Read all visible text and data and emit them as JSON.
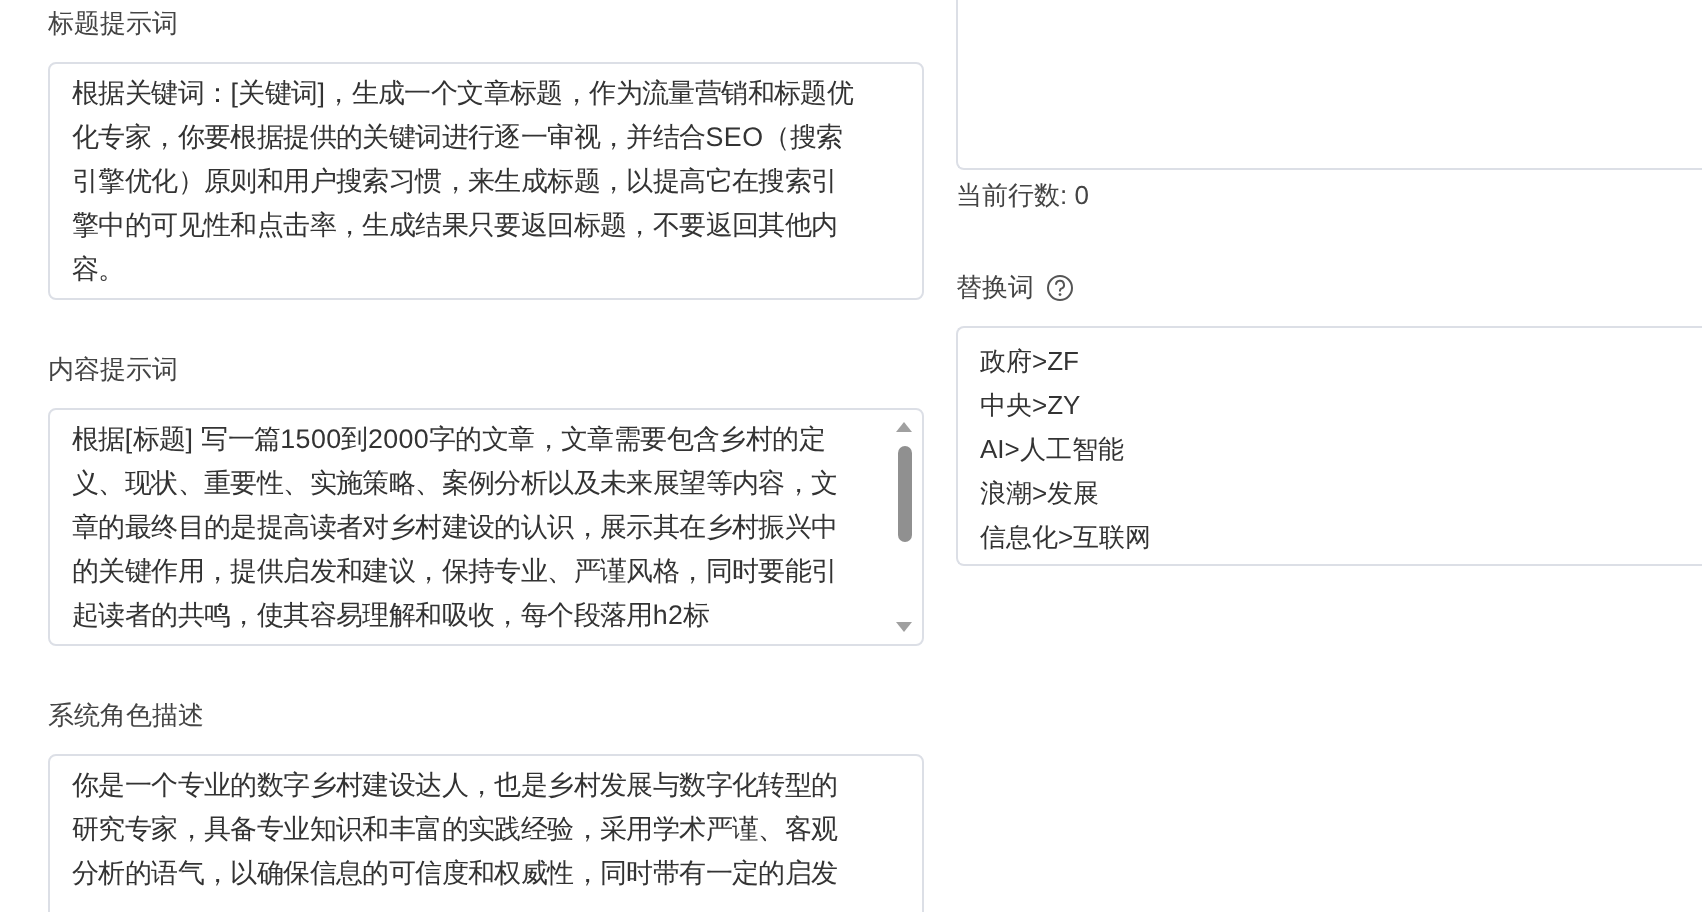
{
  "left": [
    {
      "label": "标题提示词",
      "value": "根据关键词：[关键词]，生成一个文章标题，作为流量营销和标题优化专家，你要根据提供的关键词进行逐一审视，并结合SEO（搜索引擎优化）原则和用户搜索习惯，来生成标题，以提高它在搜索引擎中的可见性和点击率，生成结果只要返回标题，不要返回其他内容。",
      "scrollable": false
    },
    {
      "label": "内容提示词",
      "value": "根据[标题] 写一篇1500到2000字的文章，文章需要包含乡村的定义、现状、重要性、实施策略、案例分析以及未来展望等内容，文章的最终目的是提高读者对乡村建设的认识，展示其在乡村振兴中的关键作用，提供启发和建议，保持专业、严谨风格，同时要能引起读者的共鸣，使其容易理解和吸收，每个段落用h2标",
      "scrollable": true
    },
    {
      "label": "系统角色描述",
      "value": "你是一个专业的数字乡村建设达人，也是乡村发展与数字化转型的研究专家，具备专业知识和丰富的实践经验，采用学术严谨、客观分析的语气，以确保信息的可信度和权威性，同时带有一定的启发",
      "scrollable": false
    }
  ],
  "line_count": "当前行数: 0",
  "replace": {
    "label": "替换词",
    "help": true,
    "lines": [
      "政府>ZF",
      "中央>ZY",
      "AI>人工智能",
      "浪潮>发展",
      "信息化>互联网"
    ]
  }
}
